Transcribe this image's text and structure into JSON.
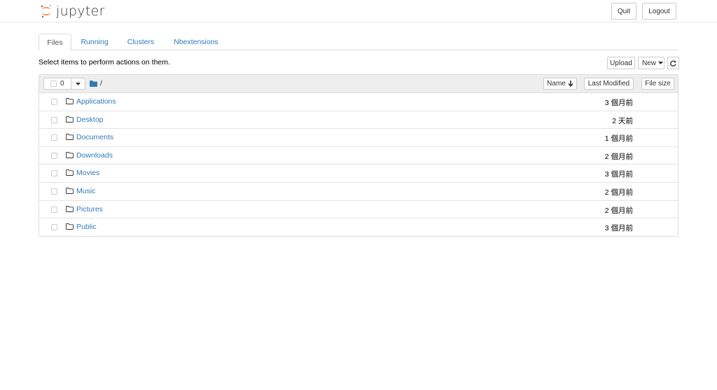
{
  "header": {
    "logo_text": "jupyter",
    "quit_label": "Quit",
    "logout_label": "Logout"
  },
  "tabs": [
    {
      "label": "Files",
      "active": true
    },
    {
      "label": "Running",
      "active": false
    },
    {
      "label": "Clusters",
      "active": false
    },
    {
      "label": "Nbextensions",
      "active": false
    }
  ],
  "toolbar": {
    "instructions": "Select items to perform actions on them.",
    "upload_label": "Upload",
    "new_label": "New",
    "refresh_icon": "refresh-icon"
  },
  "list_header": {
    "selected_count": "0",
    "path": "/",
    "name_label": "Name",
    "last_modified_label": "Last Modified",
    "file_size_label": "File size"
  },
  "items": [
    {
      "name": "Applications",
      "modified": "3 個月前"
    },
    {
      "name": "Desktop",
      "modified": "2 天前"
    },
    {
      "name": "Documents",
      "modified": "1 個月前"
    },
    {
      "name": "Downloads",
      "modified": "2 個月前"
    },
    {
      "name": "Movies",
      "modified": "3 個月前"
    },
    {
      "name": "Music",
      "modified": "2 個月前"
    },
    {
      "name": "Pictures",
      "modified": "2 個月前"
    },
    {
      "name": "Public",
      "modified": "3 個月前"
    }
  ],
  "colors": {
    "link": "#337ab7",
    "logo_orange": "#F37726",
    "header_bg": "#eeeeee"
  }
}
